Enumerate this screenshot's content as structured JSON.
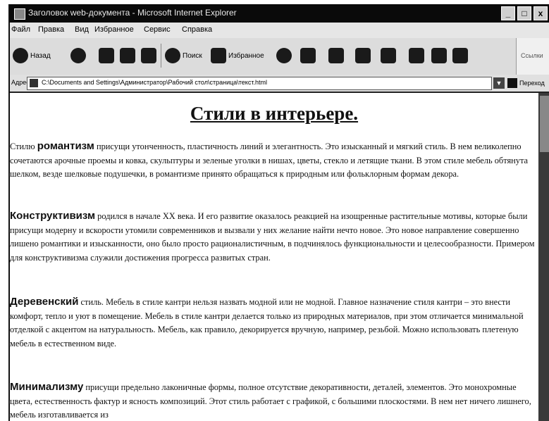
{
  "window": {
    "title": "Заголовок web-документа - Microsoft Internet Explorer",
    "controls": [
      "_",
      "□",
      "x"
    ]
  },
  "menu": [
    "Файл",
    "Правка",
    "Вид",
    "Избранное",
    "Сервис",
    "Справка"
  ],
  "toolbar": {
    "back_label": "Назад",
    "search_label": "Поиск",
    "favorites_label": "Избранное",
    "side_panel_label": "Ссылки"
  },
  "address": {
    "label": "Адрес",
    "value": "C:\\Documents and Settings\\Администратор\\Рабочий стол\\страница\\текст.html",
    "go_label": "Переход"
  },
  "content": {
    "heading": "Стили в интерьере.",
    "paragraphs": [
      {
        "term": "романтизм",
        "lead": "Стилю ",
        "text": " присущи утонченность, пластичность линий и элегантность. Это изысканный и мягкий стиль. В нем великолепно сочетаются арочные проемы и ковка, скульптуры и зеленые уголки в нишах, цветы, стекло и летящие ткани. В этом стиле мебель обтянута шелком, везде шелковые подушечки, в романтизме принято обращаться к природным или фольклорным формам декора."
      },
      {
        "term": "Конструктивизм",
        "lead": "",
        "text": " родился в начале XX века. И его развитие оказалось реакцией на изощренные растительные мотивы, которые были присущи модерну и вскорости утомили современников и вызвали у них желание найти нечто новое. Это новое направление совершенно лишено романтики и изысканности, оно было просто рационалистичным, в подчинялось функциональности и целесообразности. Примером для конструктивизма служили достижения прогресса развитых стран."
      },
      {
        "term": "Деревенский",
        "lead": "",
        "text": " стиль. Мебель в стиле кантри нельзя назвать модной или не модной. Главное назначение стиля кантри – это внести комфорт, тепло и уют в помещение. Мебель в стиле кантри делается только из природных материалов, при этом отличается минимальной отделкой с акцентом на натуральность. Мебель, как правило, декорируется вручную, например, резьбой. Можно использовать плетеную мебель в естественном виде."
      },
      {
        "term": "Минимализму",
        "lead": "",
        "text": " присущи предельно лаконичные формы, полное отсутствие декоративности, деталей, элементов. Это монохромные цвета, естественность фактур и ясность композиций. Этот стиль работает с графикой, с большими плоскостями. В нем нет ничего лишнего, мебель изготавливается из"
      }
    ]
  }
}
